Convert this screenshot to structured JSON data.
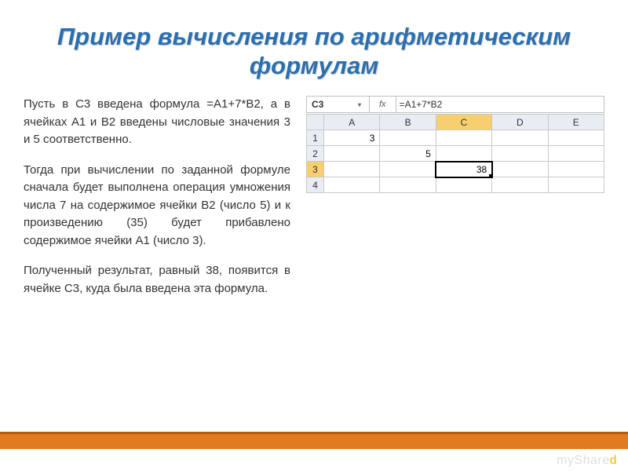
{
  "title": "Пример вычисления по арифметическим формулам",
  "paragraphs": {
    "p1": "Пусть в C3 введена формула =A1+7*B2, а в ячейках A1 и B2 введены числовые значения 3 и 5 соответственно.",
    "p2": "Тогда при вычислении по заданной формуле сначала будет выполнена операция умножения числа 7 на содержимое ячейки B2 (число 5) и к произведению (35) будет прибавлено содержимое ячейки A1 (число 3).",
    "p3": "Полученный результат, равный 38, появится в ячейке C3, куда была введена эта формула."
  },
  "formula_bar": {
    "name_box": "C3",
    "fx": "fx",
    "value": "=A1+7*B2",
    "caret": "▾"
  },
  "grid": {
    "cols": [
      "A",
      "B",
      "C",
      "D",
      "E"
    ],
    "rows": [
      "1",
      "2",
      "3",
      "4"
    ],
    "cells": {
      "A1": "3",
      "B2": "5",
      "C3": "38"
    },
    "active_col": "C",
    "active_row": "3",
    "selected_cell": "C3"
  },
  "watermark": {
    "pre": "myShare",
    "accent": "d"
  }
}
